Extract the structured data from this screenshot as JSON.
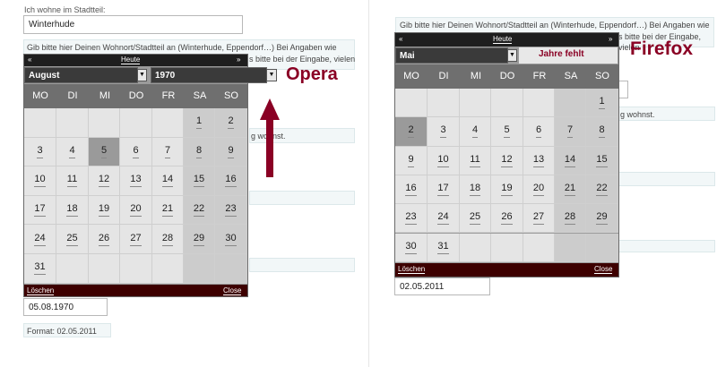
{
  "left_form": {
    "label": "Ich wohne im Stadtteil:",
    "district_value": "Winterhude",
    "info_line1": "Gib bitte hier Deinen Wohnort/Stadtteil an (Winterhude, Eppendorf…) Bei Angaben wie",
    "info_line2": "s bitte bei der Eingabe, vielen",
    "partial_text": "g wohnst.",
    "date_value": "05.08.1970",
    "format_text": "Format: 02.05.2011"
  },
  "opera_calendar": {
    "nav_prev": "«",
    "nav_today": "Heute",
    "nav_next": "»",
    "month": "August",
    "year": "1970",
    "weekdays": [
      "MO",
      "DI",
      "MI",
      "DO",
      "FR",
      "SA",
      "SO"
    ],
    "days": [
      "1",
      "2",
      "3",
      "4",
      "5",
      "6",
      "7",
      "8",
      "9",
      "10",
      "11",
      "12",
      "13",
      "14",
      "15",
      "16",
      "17",
      "18",
      "19",
      "20",
      "21",
      "22",
      "23",
      "24",
      "25",
      "26",
      "27",
      "28",
      "29",
      "30",
      "31"
    ],
    "clear_label": "Löschen",
    "close_label": "Close"
  },
  "opera_annotation": "Opera",
  "right_form": {
    "info_line1": "Gib bitte hier Deinen Wohnort/Stadtteil an (Winterhude, Eppendorf…) Bei Angaben wie",
    "info_line2": "s bitte bei der Eingabe, vielen",
    "partial_text": "g wohnst.",
    "date_value": "02.05.2011"
  },
  "firefox_calendar": {
    "nav_prev": "«",
    "nav_today": "Heute",
    "nav_next": "»",
    "month": "Mai",
    "weekdays": [
      "MO",
      "DI",
      "MI",
      "DO",
      "FR",
      "SA",
      "SO"
    ],
    "days": [
      "1",
      "2",
      "3",
      "4",
      "5",
      "6",
      "7",
      "8",
      "9",
      "10",
      "11",
      "12",
      "13",
      "14",
      "15",
      "16",
      "17",
      "18",
      "19",
      "20",
      "21",
      "22",
      "23",
      "24",
      "25",
      "26",
      "27",
      "28",
      "29",
      "30",
      "31"
    ],
    "clear_label": "Löschen",
    "close_label": "Close"
  },
  "firefox_annotation": "Firefox",
  "missing_year_annotation": "Jahre fehlt",
  "colors": {
    "annotation": "#8a0024",
    "footer": "#3d0000",
    "weekday_header": "#6f6f6f",
    "weekend_cell": "#cccccc",
    "day_cell": "#e5e5e5"
  }
}
